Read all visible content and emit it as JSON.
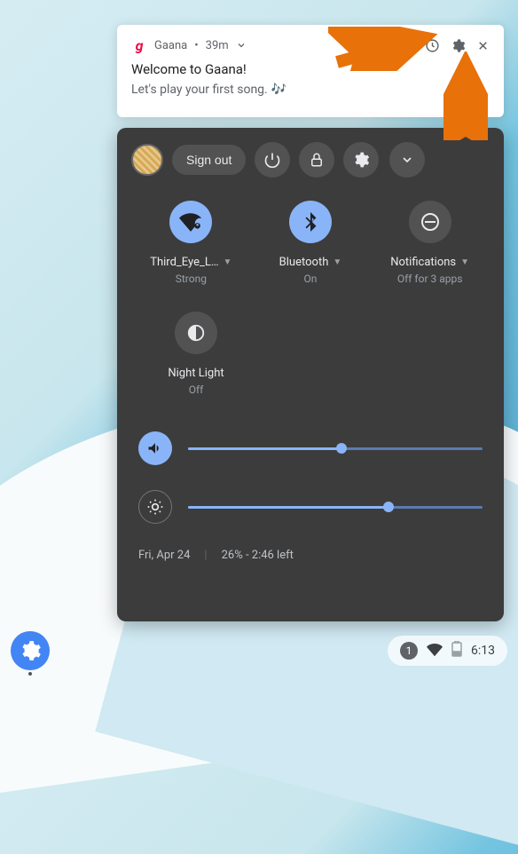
{
  "notification": {
    "app_icon_letter": "g",
    "app_name": "Gaana",
    "separator": "•",
    "time": "39m",
    "title": "Welcome to Gaana!",
    "body": "Let's play your first song.",
    "emoji": "🎶"
  },
  "quick_settings": {
    "sign_out": "Sign out",
    "toggles": {
      "wifi": {
        "label": "Third_Eye_L…",
        "status": "Strong"
      },
      "bluetooth": {
        "label": "Bluetooth",
        "status": "On"
      },
      "notifications": {
        "label": "Notifications",
        "status": "Off for 3 apps"
      },
      "night_light": {
        "label": "Night Light",
        "status": "Off"
      }
    },
    "volume_percent": 52,
    "brightness_percent": 68,
    "date": "Fri, Apr 24",
    "battery": "26% - 2:46 left"
  },
  "shelf": {
    "notification_count": "1",
    "time": "6:13"
  },
  "colors": {
    "accent": "#8ab4f8",
    "annotation": "#e8710a"
  }
}
